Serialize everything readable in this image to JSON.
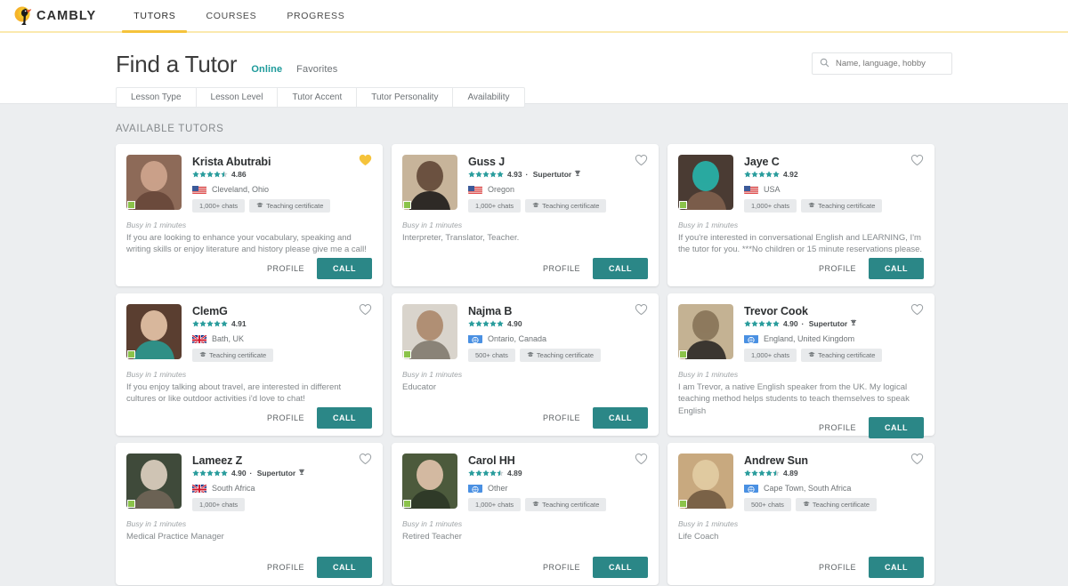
{
  "brand": {
    "name": "CAMBLY",
    "logo_icon": "toucan-logo-icon",
    "accent_yellow": "#f5c33b",
    "accent_teal": "#1d9a9a",
    "call_button_color": "#2b8787",
    "favorite_color": "#f5c33b"
  },
  "nav": {
    "items": [
      {
        "label": "TUTORS",
        "active": true
      },
      {
        "label": "COURSES",
        "active": false
      },
      {
        "label": "PROGRESS",
        "active": false
      }
    ]
  },
  "header": {
    "title": "Find a Tutor",
    "tabs": [
      {
        "label": "Online",
        "active": true
      },
      {
        "label": "Favorites",
        "active": false
      }
    ],
    "filters": [
      "Lesson Type",
      "Lesson Level",
      "Tutor Accent",
      "Tutor Personality",
      "Availability"
    ]
  },
  "search": {
    "icon": "search-icon",
    "placeholder": "Name, language, hobby",
    "value": ""
  },
  "main": {
    "section_label": "AVAILABLE TUTORS",
    "profile_label": "PROFILE",
    "call_label": "CALL",
    "tutors": [
      {
        "name": "Krista Abutrabi",
        "rating": "4.86",
        "stars": 4.5,
        "supertutor": false,
        "flag": "us",
        "location": "Cleveland, Ohio",
        "pills": [
          "1,000+ chats",
          "Teaching certificate"
        ],
        "status": "Busy in 1 minutes",
        "bio": "If you are looking to enhance your vocabulary, speaking and writing skills or enjoy literature and history please give me a call!",
        "favorited": true,
        "avatar_colors": [
          "#8d6a58",
          "#c9a089",
          "#6b4a3c"
        ]
      },
      {
        "name": "Guss J",
        "rating": "4.93",
        "stars": 5,
        "supertutor": true,
        "supertutor_label": "Supertutor",
        "flag": "us",
        "location": "Oregon",
        "pills": [
          "1,000+ chats",
          "Teaching certificate"
        ],
        "status": "Busy in 1 minutes",
        "bio": "Interpreter, Translator, Teacher.",
        "favorited": false,
        "avatar_colors": [
          "#c7b49a",
          "#6b5240",
          "#2e2a26"
        ]
      },
      {
        "name": "Jaye C",
        "rating": "4.92",
        "stars": 5,
        "supertutor": false,
        "flag": "us",
        "location": "USA",
        "pills": [
          "1,000+ chats",
          "Teaching certificate"
        ],
        "status": "Busy in 1 minutes",
        "bio": "If you're interested in conversational English and LEARNING, I'm the tutor for you.  ***No children or 15 minute reservations please.",
        "favorited": false,
        "avatar_colors": [
          "#4a3b33",
          "#2aa9a0",
          "#7a5c4a"
        ]
      },
      {
        "name": "ClemG",
        "rating": "4.91",
        "stars": 5,
        "supertutor": false,
        "flag": "uk",
        "location": "Bath, UK",
        "pills": [
          "Teaching certificate"
        ],
        "status": "Busy in 1 minutes",
        "bio": "If you enjoy talking about travel, are interested in different cultures or like outdoor activities i'd love to chat!",
        "favorited": false,
        "avatar_colors": [
          "#5a3e30",
          "#d8b79c",
          "#2f8f86"
        ]
      },
      {
        "name": "Najma B",
        "rating": "4.90",
        "stars": 5,
        "supertutor": false,
        "flag": "other",
        "location": "Ontario, Canada",
        "pills": [
          "500+ chats",
          "Teaching certificate"
        ],
        "status": "Busy in 1 minutes",
        "bio": "Educator",
        "favorited": false,
        "avatar_colors": [
          "#d9d4cc",
          "#b08f74",
          "#8a8378"
        ]
      },
      {
        "name": "Trevor Cook",
        "rating": "4.90",
        "stars": 5,
        "supertutor": true,
        "supertutor_label": "Supertutor",
        "flag": "other",
        "location": "England, United Kingdom",
        "pills": [
          "1,000+ chats",
          "Teaching certificate"
        ],
        "status": "Busy in 1 minutes",
        "bio": "I am Trevor, a native English speaker from the UK. My logical teaching method helps students to teach themselves to speak English",
        "favorited": false,
        "avatar_colors": [
          "#c4b293",
          "#8d7a5e",
          "#3b3630"
        ]
      },
      {
        "name": "Lameez Z",
        "rating": "4.90",
        "stars": 5,
        "supertutor": true,
        "supertutor_label": "Supertutor",
        "flag": "uk",
        "location": "South Africa",
        "pills": [
          "1,000+ chats"
        ],
        "status": "Busy in 1 minutes",
        "bio": "Medical Practice Manager",
        "favorited": false,
        "avatar_colors": [
          "#3f4a3a",
          "#cfc4b4",
          "#6b6254"
        ]
      },
      {
        "name": "Carol HH",
        "rating": "4.89",
        "stars": 4.5,
        "supertutor": false,
        "flag": "other",
        "location": "Other",
        "pills": [
          "1,000+ chats",
          "Teaching certificate"
        ],
        "status": "Busy in 1 minutes",
        "bio": "Retired Teacher",
        "favorited": false,
        "avatar_colors": [
          "#4c5a3c",
          "#d3b9a1",
          "#2f3a28"
        ]
      },
      {
        "name": "Andrew Sun",
        "rating": "4.89",
        "stars": 4.5,
        "supertutor": false,
        "flag": "other",
        "location": "Cape Town, South Africa",
        "pills": [
          "500+ chats",
          "Teaching certificate"
        ],
        "status": "Busy in 1 minutes",
        "bio": "Life Coach",
        "favorited": false,
        "avatar_colors": [
          "#c8a97f",
          "#e0c9a0",
          "#7a6247"
        ]
      }
    ]
  }
}
